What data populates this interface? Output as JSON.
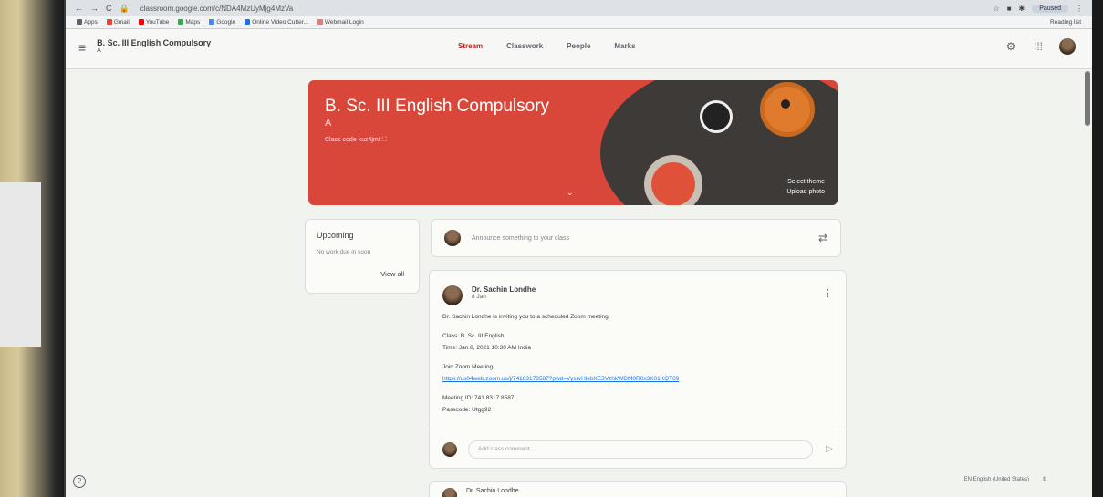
{
  "browser": {
    "url": "classroom.google.com/c/NDA4MzUyMjg4MzVa",
    "paused_label": "Paused",
    "bookmarks": [
      {
        "label": "Apps",
        "color": "#5f6368"
      },
      {
        "label": "Gmail",
        "color": "#ea4335"
      },
      {
        "label": "YouTube",
        "color": "#ff0000"
      },
      {
        "label": "Maps",
        "color": "#34a853"
      },
      {
        "label": "Google",
        "color": "#4285f4"
      },
      {
        "label": "Online Video Cutter...",
        "color": "#1a73e8"
      },
      {
        "label": "Webmail Login",
        "color": "#e67c73"
      }
    ],
    "reading_list": "Reading list"
  },
  "header": {
    "class_title": "B. Sc. III English Compulsory",
    "class_section": "A",
    "tabs": [
      {
        "label": "Stream",
        "active": true
      },
      {
        "label": "Classwork",
        "active": false
      },
      {
        "label": "People",
        "active": false
      },
      {
        "label": "Marks",
        "active": false
      }
    ]
  },
  "banner": {
    "title": "B. Sc. III English Compulsory",
    "section": "A",
    "class_code": "Class code  kuz4jmt",
    "select_theme": "Select theme",
    "upload_photo": "Upload photo",
    "color": "#d9473a"
  },
  "upcoming": {
    "title": "Upcoming",
    "no_work": "No work due in soon",
    "view_all": "View all"
  },
  "announce": {
    "placeholder": "Announce something to your class"
  },
  "post": {
    "author": "Dr. Sachin Londhe",
    "date": "8 Jan",
    "line1": "Dr. Sachin Londhe is inviting you to a scheduled Zoom meeting.",
    "class_line": "Class: B. Sc. III English",
    "time_line": "Time: Jan 8, 2021 10:30 AM India",
    "join_label": "Join Zoom Meeting",
    "link": "https://us04web.zoom.us/j/74183178587?pwd=VysrvHlebXE3VzhkWDM0R0x3K01KQT09",
    "meeting_id": "Meeting ID: 741 8317 8587",
    "passcode": "Passcode: Utgg92",
    "comment_placeholder": "Add class comment..."
  },
  "post2": {
    "author": "Dr. Sachin Londhe"
  },
  "footer": {
    "language": "EN English (United States)",
    "help": "?"
  }
}
